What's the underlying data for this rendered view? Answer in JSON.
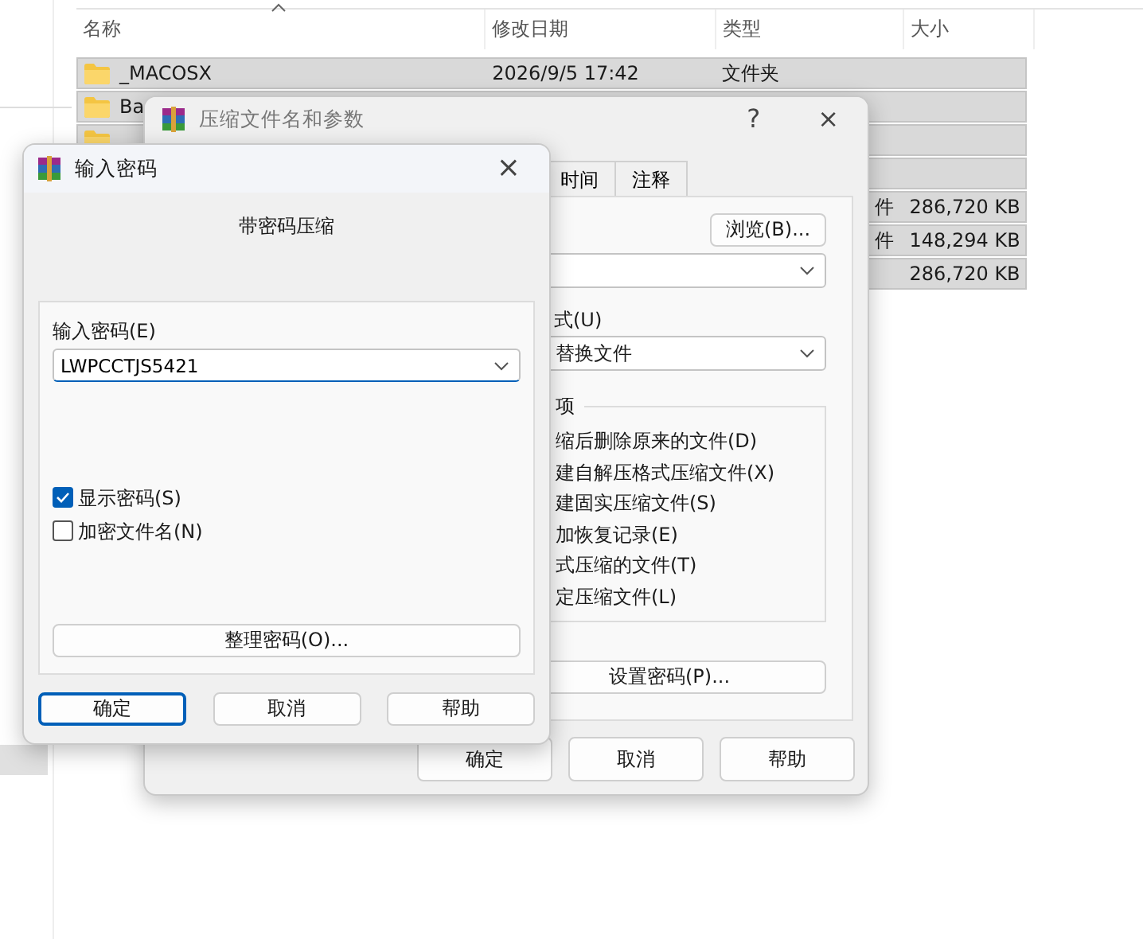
{
  "explorer": {
    "columns": [
      "名称",
      "修改日期",
      "类型",
      "大小"
    ],
    "rows": [
      {
        "name": "_MACOSX",
        "date": "2026/9/5 17:42",
        "type": "文件夹",
        "kind": "folder",
        "selected": true
      },
      {
        "name": "Ba",
        "kind": "folder",
        "selected": true
      },
      {
        "kind": "folder",
        "selected": true
      },
      {
        "selected": true
      },
      {
        "type_tail": "件",
        "size": "286,720 KB",
        "selected": true
      },
      {
        "type_tail": "件",
        "size": "148,294 KB",
        "selected": true
      },
      {
        "size": "286,720 KB",
        "selected": true
      }
    ]
  },
  "archive_dialog": {
    "title": "压缩文件名和参数",
    "help": "?",
    "close": "×",
    "tabs": [
      "时间",
      "注释"
    ],
    "browse_button": "浏览(B)...",
    "update_mode_label": "式(U)",
    "update_mode": "替换文件",
    "options_title": "项",
    "options": [
      {
        "label": "缩后删除原来的文件(D)"
      },
      {
        "label": "建自解压格式压缩文件(X)"
      },
      {
        "label": "建固实压缩文件(S)"
      },
      {
        "label": "加恢复记录(E)"
      },
      {
        "label": "式压缩的文件(T)"
      },
      {
        "label": "定压缩文件(L)"
      }
    ],
    "set_password_button": "设置密码(P)...",
    "buttons": [
      "确定",
      "取消",
      "帮助"
    ]
  },
  "password_dialog": {
    "title": "输入密码",
    "close": "×",
    "heading": "带密码压缩",
    "password_label": "输入密码(E)",
    "password": "LWPCCTJS5421",
    "options": [
      {
        "label": "显示密码(S)",
        "checked": true
      },
      {
        "label": "加密文件名(N)",
        "checked": false
      }
    ],
    "organize_button": "整理密码(O)...",
    "buttons": [
      {
        "label": "确定",
        "default": true
      },
      {
        "label": "取消",
        "default": false
      },
      {
        "label": "帮助",
        "default": false
      }
    ]
  }
}
